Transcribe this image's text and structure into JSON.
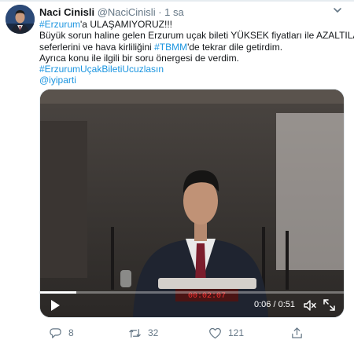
{
  "tweet": {
    "author_name": "Naci Cinisli",
    "handle": "@NaciCinisli",
    "separator": "·",
    "time": "1 sa",
    "lines": [
      [
        {
          "text": "#Erzurum",
          "link": true
        },
        {
          "text": "'a ULAŞAMIYORUZ!!!",
          "link": false
        }
      ],
      [
        {
          "text": "Büyük sorun haline gelen Erzurum uçak bileti YÜKSEK fiyatları ile AZALTILAN",
          "link": false
        }
      ],
      [
        {
          "text": "seferlerini ve hava kirliliğini ",
          "link": false
        },
        {
          "text": "#TBMM",
          "link": true
        },
        {
          "text": "'de tekrar dile getirdim.",
          "link": false
        }
      ],
      [
        {
          "text": "Ayrıca konu ile ilgili bir soru önergesi de verdim.",
          "link": false
        }
      ],
      [
        {
          "text": "#ErzurumUçakBiletiUcuzlasın",
          "link": true
        }
      ],
      [
        {
          "text": "@iyiparti",
          "link": true
        }
      ]
    ]
  },
  "video": {
    "timecode": "0:06 / 0:51",
    "progress": 0.118,
    "clock_overlay": "00:02:07"
  },
  "actions": {
    "replies": "8",
    "retweets": "32",
    "likes": "121"
  },
  "colors": {
    "link": "#1b95e0",
    "muted": "#657786",
    "text": "#14171a"
  }
}
